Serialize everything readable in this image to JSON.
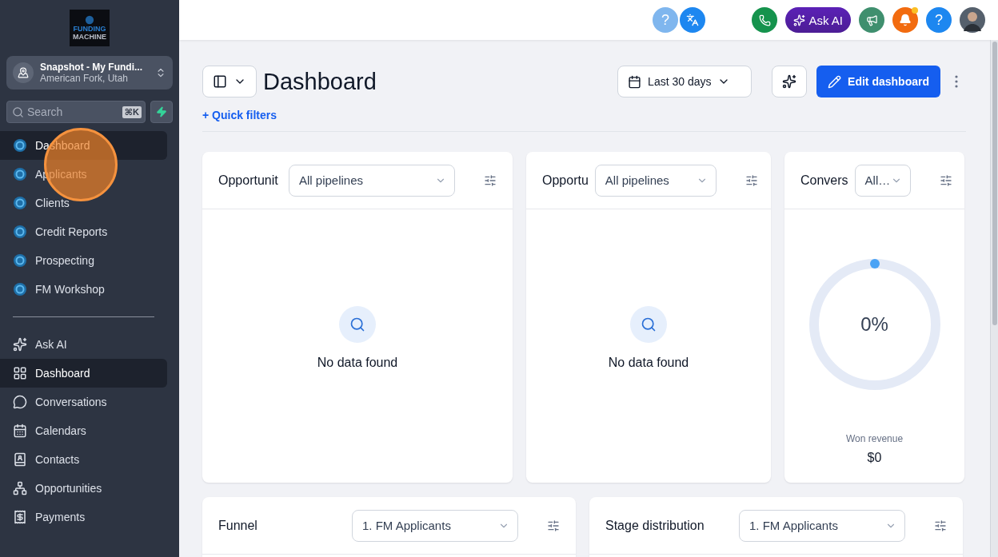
{
  "sidebar": {
    "logo": {
      "line_1": "FUNDING",
      "line_2": "MACHINE"
    },
    "account": {
      "name": "Snapshot - My Fundi...",
      "location": "American Fork, Utah"
    },
    "search": {
      "placeholder": "Search",
      "shortcut": "⌘K"
    },
    "app_items": [
      {
        "label": "Dashboard",
        "selected": true
      },
      {
        "label": "Applicants",
        "selected": false
      },
      {
        "label": "Clients",
        "selected": false
      },
      {
        "label": "Credit Reports",
        "selected": false
      },
      {
        "label": "Prospecting",
        "selected": false
      },
      {
        "label": "FM Workshop",
        "selected": false
      }
    ],
    "nav_items": [
      {
        "label": "Ask AI",
        "kind": "sparkle",
        "selected": false
      },
      {
        "label": "Dashboard",
        "kind": "grid",
        "selected": true
      },
      {
        "label": "Conversations",
        "kind": "chat",
        "selected": false
      },
      {
        "label": "Calendars",
        "kind": "calendar",
        "selected": false
      },
      {
        "label": "Contacts",
        "kind": "contacts",
        "selected": false
      },
      {
        "label": "Opportunities",
        "kind": "network",
        "selected": false
      },
      {
        "label": "Payments",
        "kind": "payment",
        "selected": false
      }
    ]
  },
  "topbar": {
    "help_left": "?",
    "ask_ai": "Ask AI",
    "notification_dot": true,
    "help_right": "?"
  },
  "header": {
    "title": "Dashboard",
    "date_range": "Last 30 days",
    "edit_button": "Edit dashboard",
    "quick_filters": "Quick filters",
    "quick_filters_mark": "+"
  },
  "cards": [
    {
      "title": "Opportunit",
      "select": "All pipelines",
      "kind": "empty",
      "message": "No data found"
    },
    {
      "title": "Opportu",
      "select": "All pipelines",
      "kind": "empty",
      "message": "No data found"
    },
    {
      "title": "Convers",
      "select": "All…",
      "kind": "gauge",
      "value": "0%",
      "level": 0,
      "caption": "Won revenue",
      "amount": "$0"
    }
  ],
  "bottom_cards": [
    {
      "title": "Funnel",
      "select": "1. FM Applicants"
    },
    {
      "title": "Stage distribution",
      "select": "1. FM Applicants"
    }
  ]
}
